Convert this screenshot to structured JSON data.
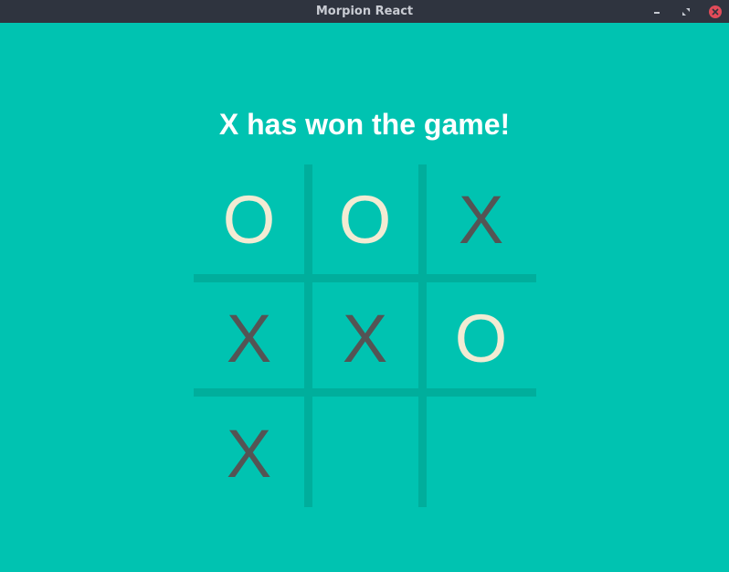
{
  "window": {
    "title": "Morpion React"
  },
  "game": {
    "status": "X has won the game!",
    "board": [
      "O",
      "O",
      "X",
      "X",
      "X",
      "O",
      "X",
      "",
      ""
    ]
  },
  "colors": {
    "background": "#00c3b1",
    "grid_lines": "#00ae9c",
    "x_mark": "#545454",
    "o_mark": "#f2ebd3",
    "status_text": "#ffffff",
    "titlebar": "#2f343f",
    "close_button": "#e14b59"
  },
  "icons": {
    "minimize": "minimize-icon",
    "maximize": "maximize-icon",
    "close": "close-icon"
  }
}
